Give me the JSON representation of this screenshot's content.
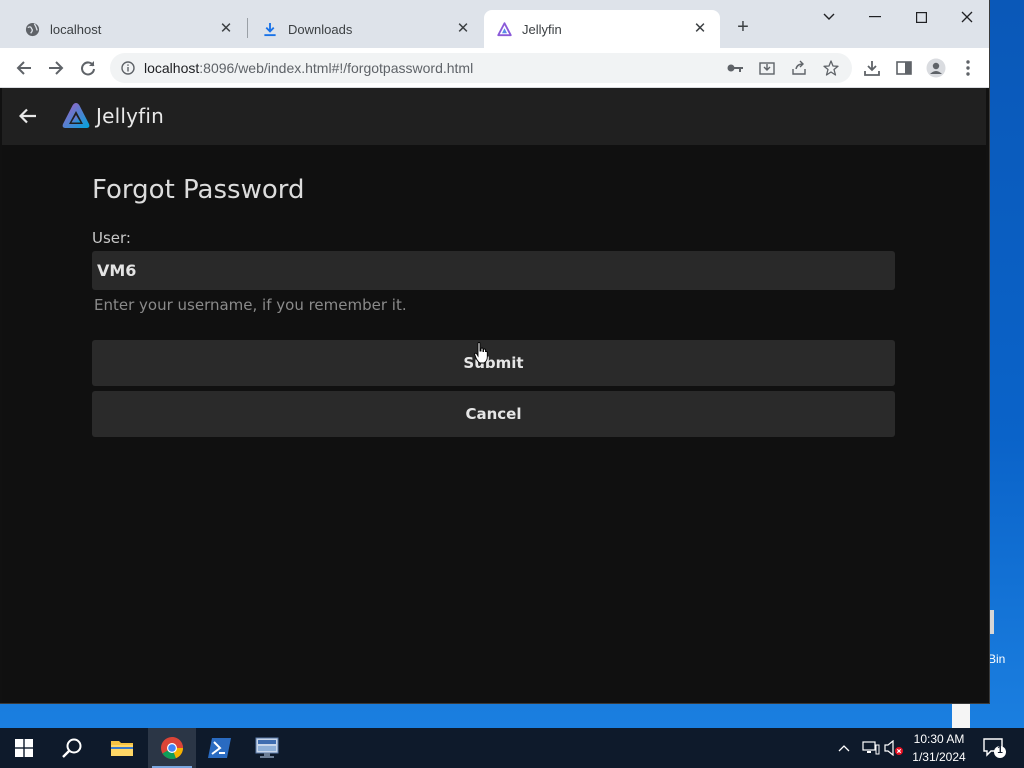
{
  "browser": {
    "tabs": [
      {
        "title": "localhost",
        "icon": "globe-icon",
        "active": false
      },
      {
        "title": "Downloads",
        "icon": "download-icon",
        "active": false
      },
      {
        "title": "Jellyfin",
        "icon": "jellyfin-icon",
        "active": true
      }
    ],
    "url_host": "localhost",
    "url_rest": ":8096/web/index.html#!/forgotpassword.html"
  },
  "app": {
    "name": "Jellyfin"
  },
  "page": {
    "title": "Forgot Password",
    "user_label": "User:",
    "user_value": "VM6",
    "help_text": "Enter your username, if you remember it.",
    "submit_label": "Submit",
    "cancel_label": "Cancel"
  },
  "desktop": {
    "partial_label": "Bin"
  },
  "taskbar": {
    "time": "10:30 AM",
    "date": "1/31/2024",
    "notification_count": "1"
  },
  "colors": {
    "jellyfin_purple": "#aa5cc3",
    "jellyfin_blue": "#00a4dc",
    "page_background": "#101010",
    "header_background": "#202020"
  }
}
